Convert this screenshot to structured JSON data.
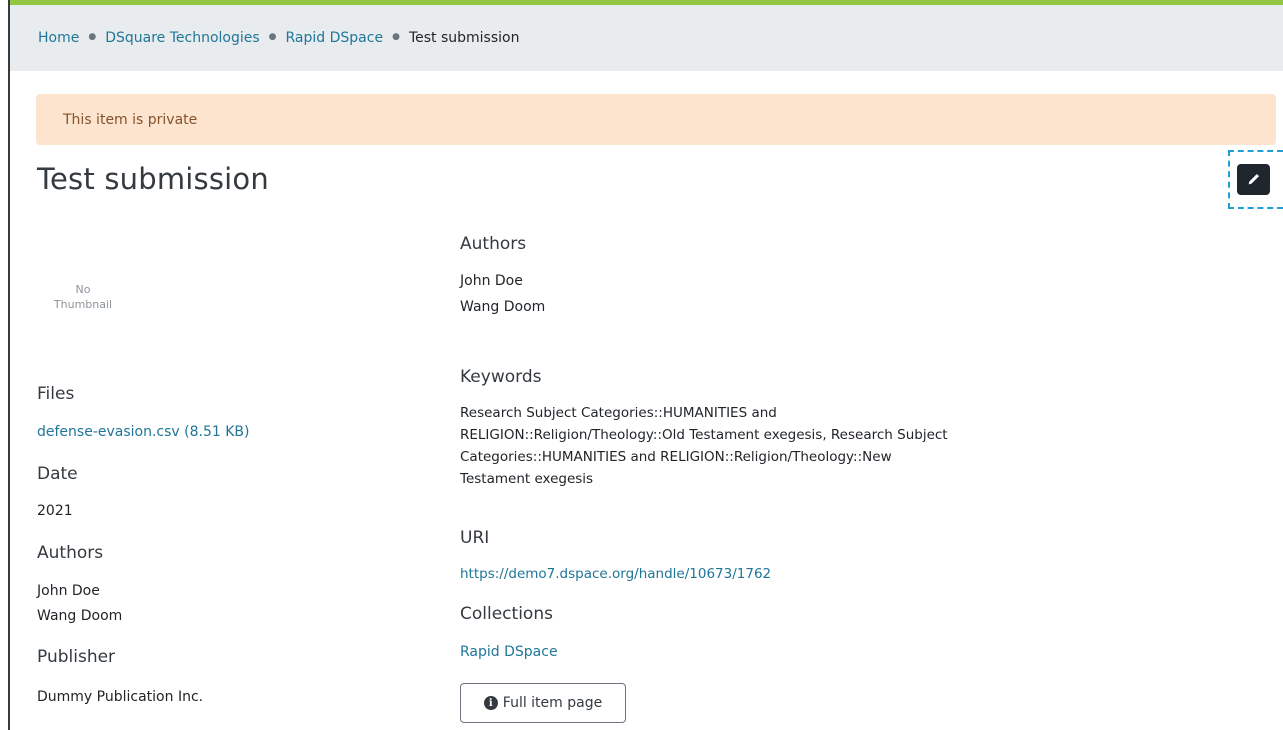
{
  "breadcrumb": {
    "items": [
      "Home",
      "DSquare Technologies",
      "Rapid DSpace"
    ],
    "current": "Test submission"
  },
  "alert": {
    "text": "This item is private"
  },
  "item": {
    "title": "Test submission"
  },
  "edit_button": {
    "icon": "pencil-icon"
  },
  "thumbnail": {
    "line1": "No",
    "line2": "Thumbnail"
  },
  "left": {
    "files_heading": "Files",
    "file_link": "defense-evasion.csv (8.51 KB)",
    "date_heading": "Date",
    "date_value": "2021",
    "authors_heading": "Authors",
    "authors": [
      "John Doe",
      "Wang Doom"
    ],
    "publisher_heading": "Publisher",
    "publisher_value": "Dummy Publication Inc."
  },
  "right": {
    "authors_heading": "Authors",
    "authors": [
      "John Doe",
      "Wang Doom"
    ],
    "keywords_heading": "Keywords",
    "keywords_lines": [
      "Research Subject Categories::HUMANITIES and",
      "RELIGION::Religion/Theology::Old Testament exegesis, Research Subject",
      "Categories::HUMANITIES and RELIGION::Religion/Theology::New",
      "Testament exegesis"
    ],
    "uri_heading": "URI",
    "uri_value": "https://demo7.dspace.org/handle/10673/1762",
    "collections_heading": "Collections",
    "collection_link": "Rapid DSpace",
    "full_item_button": "Full item page"
  },
  "colors": {
    "accent": "#92c642",
    "link": "#207698",
    "alert_bg": "#fce4cf",
    "alert_text": "#85522b"
  }
}
